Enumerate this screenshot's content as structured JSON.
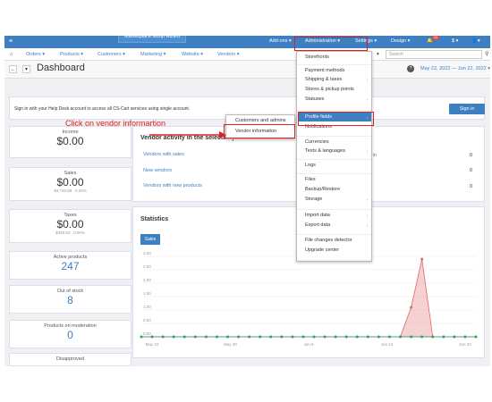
{
  "topbar": {
    "wizard_label": "Marketplace setup wizard",
    "addons": "Add-ons ▾",
    "administration": "Administration ▾",
    "settings": "Settings ▾",
    "design": "Design ▾",
    "notification_count": "11",
    "currency": "$ ▾"
  },
  "navbar": {
    "orders": "Orders ▾",
    "products": "Products ▾",
    "customers": "Customers ▾",
    "marketing": "Marketing ▾",
    "website": "Website ▾",
    "vendors": "Vendors ▾",
    "search_placeholder": "Search"
  },
  "header": {
    "title": "Dashboard",
    "help": "?",
    "date_range": "May 22, 2022 — Jun 22, 2022 ▾"
  },
  "notice": {
    "text": "Sign in with your Help Desk account to access all CS-Cart services using single account.",
    "signin": "Sign in"
  },
  "cards": {
    "income_label": "Income",
    "income_value": "$0.00",
    "sales_label": "Sales",
    "sales_value": "$0.00",
    "sales_sub": "$3,746.89 , 0.00%",
    "taxes_label": "Taxes",
    "taxes_value": "$0.00",
    "taxes_sub": "$340.63 , 0.00%",
    "active_label": "Active products",
    "active_value": "247",
    "outofstock_label": "Out of stock",
    "outofstock_value": "8",
    "moderation_label": "Products on moderation",
    "moderation_value": "0",
    "disapproved_label": "Disapproved"
  },
  "vendor_activity": {
    "title": "Vendor activity in the selected period",
    "rows": [
      {
        "label": "Vendors with sales",
        "value": "0"
      },
      {
        "label": "New vendors",
        "value": "0"
      },
      {
        "label": "Vendors with new products",
        "value": "0"
      }
    ],
    "partial_link": "ed in"
  },
  "statistics": {
    "title": "Statistics",
    "sales_button": "Sales"
  },
  "chart_data": {
    "type": "area",
    "x_ticks": [
      "May 23",
      "May 30",
      "Jun 6",
      "Jun 13",
      "Jun 20"
    ],
    "y_ticks": [
      "0.00",
      "0.50",
      "1.00",
      "1.50",
      "2.00",
      "2.50",
      "3.00"
    ],
    "ylim": [
      0,
      3
    ],
    "series": [
      {
        "color": "#e06666",
        "values": [
          0,
          0,
          0,
          0,
          0,
          0,
          0,
          0,
          0,
          0,
          0,
          0,
          0,
          0,
          0,
          0,
          0,
          0,
          0,
          0,
          0,
          0,
          0,
          0,
          0,
          1.1,
          2.9,
          0,
          0,
          0,
          0,
          0
        ]
      },
      {
        "color": "#2e9e6b",
        "values": [
          0,
          0,
          0,
          0,
          0,
          0,
          0,
          0,
          0,
          0,
          0,
          0,
          0,
          0,
          0,
          0,
          0,
          0,
          0,
          0,
          0,
          0,
          0,
          0,
          0,
          0,
          0,
          0,
          0,
          0,
          0,
          0
        ]
      }
    ]
  },
  "admin_menu": {
    "items": [
      {
        "label": "Storefronts"
      },
      {
        "label": "Payment methods"
      },
      {
        "label": "Shipping & taxes",
        "arrow": "›"
      },
      {
        "label": "Stores & pickup points"
      },
      {
        "label": "Statuses",
        "arrow": "›"
      },
      {
        "label": "Profile fields",
        "arrow": "›"
      },
      {
        "label": "Notifications"
      },
      {
        "label": "Currencies"
      },
      {
        "label": "Texts & languages",
        "arrow": "›"
      },
      {
        "label": "Logs"
      },
      {
        "label": "Files"
      },
      {
        "label": "Backup/Restore"
      },
      {
        "label": "Storage",
        "arrow": "›"
      },
      {
        "label": "Import data",
        "arrow": "›"
      },
      {
        "label": "Export data",
        "arrow": "›"
      },
      {
        "label": "File changes detector"
      },
      {
        "label": "Upgrade center"
      }
    ]
  },
  "profile_submenu": {
    "items": [
      "Customers and admins",
      "Vendor information"
    ]
  },
  "annotation": {
    "text": "Click on vendor informartion"
  },
  "colors": {
    "primary": "#3d7fc1",
    "annotation": "#e02020"
  }
}
